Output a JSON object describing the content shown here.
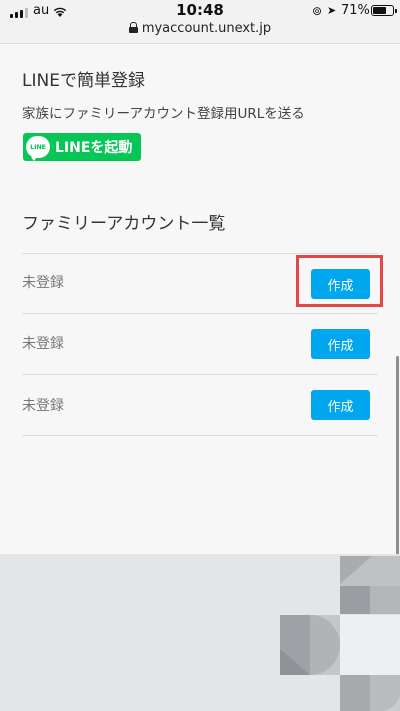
{
  "status_bar": {
    "carrier": "au",
    "time": "10:48",
    "battery_percent": "71%",
    "battery_level": 0.71,
    "url": "myaccount.unext.jp"
  },
  "line_section": {
    "title": "LINEで簡単登録",
    "description": "家族にファミリーアカウント登録用URLを送る",
    "button_label": "LINEを起動",
    "logo_text": "LINE",
    "brand_color": "#06c755"
  },
  "family_section": {
    "title": "ファミリーアカウント一覧",
    "rows": [
      {
        "status": "未登録",
        "button_label": "作成"
      },
      {
        "status": "未登録",
        "button_label": "作成"
      },
      {
        "status": "未登録",
        "button_label": "作成"
      }
    ],
    "button_color": "#00a6ee"
  },
  "colors": {
    "highlight": "#e54646"
  }
}
